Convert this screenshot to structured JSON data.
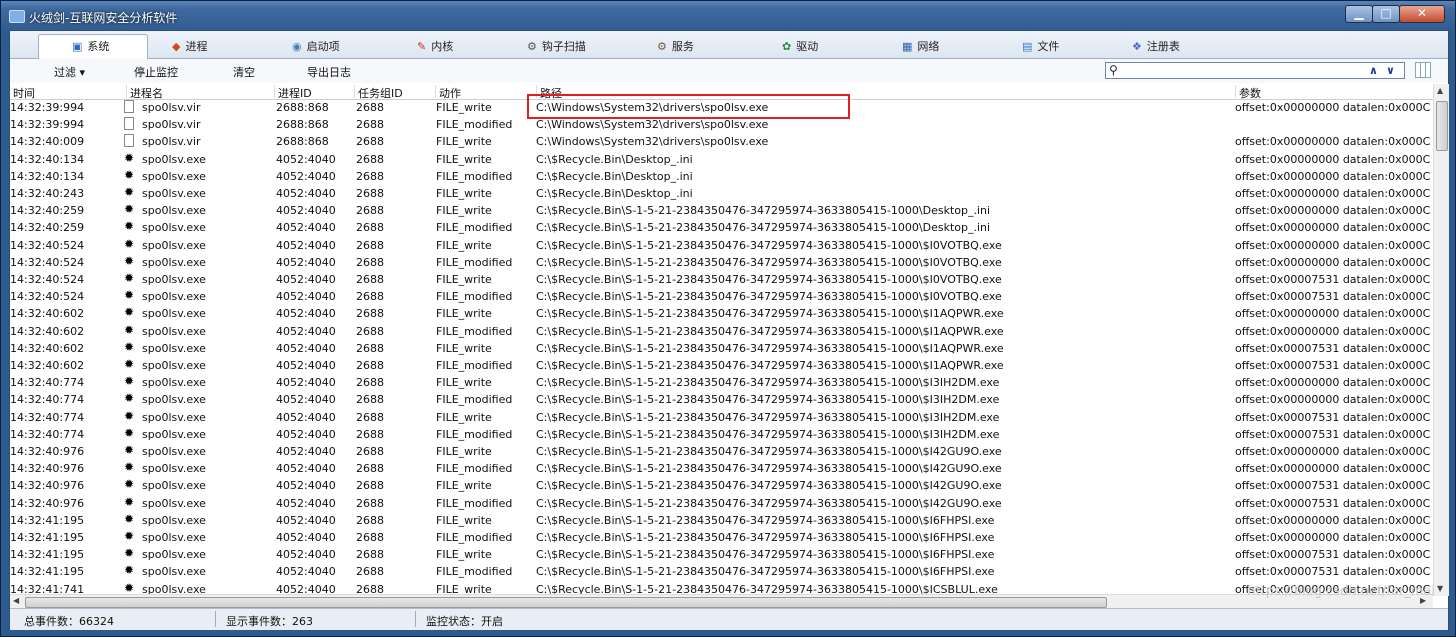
{
  "window": {
    "title": "火绒剑-互联网安全分析软件"
  },
  "tabs": [
    {
      "label": "系统",
      "icon": "system-icon",
      "glyph": "▣",
      "color": "#2b6cc4"
    },
    {
      "label": "进程",
      "icon": "process-icon",
      "glyph": "◆",
      "color": "#d04a1a"
    },
    {
      "label": "启动项",
      "icon": "startup-icon",
      "glyph": "◉",
      "color": "#4a7ab8"
    },
    {
      "label": "内核",
      "icon": "kernel-icon",
      "glyph": "✎",
      "color": "#c03030"
    },
    {
      "label": "钩子扫描",
      "icon": "hook-icon",
      "glyph": "⚙",
      "color": "#555"
    },
    {
      "label": "服务",
      "icon": "service-icon",
      "glyph": "⚙",
      "color": "#7a5a3a"
    },
    {
      "label": "驱动",
      "icon": "driver-icon",
      "glyph": "✿",
      "color": "#2a8a3a"
    },
    {
      "label": "网络",
      "icon": "network-icon",
      "glyph": "▦",
      "color": "#2b5fa8"
    },
    {
      "label": "文件",
      "icon": "file-icon",
      "glyph": "▤",
      "color": "#3a7ac8"
    },
    {
      "label": "注册表",
      "icon": "registry-icon",
      "glyph": "❖",
      "color": "#4a6ab8"
    }
  ],
  "toolbar": {
    "filter": "过滤 ▾",
    "stop": "停止监控",
    "clear": "清空",
    "export": "导出日志"
  },
  "columns": {
    "time": "时间",
    "process": "进程名",
    "pid": "进程ID",
    "taskgroup": "任务组ID",
    "action": "动作",
    "path": "路径",
    "params": "参数"
  },
  "rows": [
    {
      "time": "14:32:39:994",
      "icon": "file",
      "proc": "spo0lsv.vir",
      "pid": "2688:868",
      "tg": "2688",
      "act": "FILE_write",
      "path": "C:\\Windows\\System32\\drivers\\spo0lsv.exe",
      "param": "offset:0x00000000 datalen:0x000C"
    },
    {
      "time": "14:32:39:994",
      "icon": "file",
      "proc": "spo0lsv.vir",
      "pid": "2688:868",
      "tg": "2688",
      "act": "FILE_modified",
      "path": "C:\\Windows\\System32\\drivers\\spo0lsv.exe",
      "param": ""
    },
    {
      "time": "14:32:40:009",
      "icon": "file",
      "proc": "spo0lsv.vir",
      "pid": "2688:868",
      "tg": "2688",
      "act": "FILE_write",
      "path": "C:\\Windows\\System32\\drivers\\spo0lsv.exe",
      "param": "offset:0x00000000 datalen:0x000C"
    },
    {
      "time": "14:32:40:134",
      "icon": "exe",
      "proc": "spo0lsv.exe",
      "pid": "4052:4040",
      "tg": "2688",
      "act": "FILE_write",
      "path": "C:\\$Recycle.Bin\\Desktop_.ini",
      "param": "offset:0x00000000 datalen:0x000C"
    },
    {
      "time": "14:32:40:134",
      "icon": "exe",
      "proc": "spo0lsv.exe",
      "pid": "4052:4040",
      "tg": "2688",
      "act": "FILE_modified",
      "path": "C:\\$Recycle.Bin\\Desktop_.ini",
      "param": "offset:0x00000000 datalen:0x000C"
    },
    {
      "time": "14:32:40:243",
      "icon": "exe",
      "proc": "spo0lsv.exe",
      "pid": "4052:4040",
      "tg": "2688",
      "act": "FILE_write",
      "path": "C:\\$Recycle.Bin\\Desktop_.ini",
      "param": "offset:0x00000000 datalen:0x000C"
    },
    {
      "time": "14:32:40:259",
      "icon": "exe",
      "proc": "spo0lsv.exe",
      "pid": "4052:4040",
      "tg": "2688",
      "act": "FILE_write",
      "path": "C:\\$Recycle.Bin\\S-1-5-21-2384350476-347295974-3633805415-1000\\Desktop_.ini",
      "param": "offset:0x00000000 datalen:0x000C"
    },
    {
      "time": "14:32:40:259",
      "icon": "exe",
      "proc": "spo0lsv.exe",
      "pid": "4052:4040",
      "tg": "2688",
      "act": "FILE_modified",
      "path": "C:\\$Recycle.Bin\\S-1-5-21-2384350476-347295974-3633805415-1000\\Desktop_.ini",
      "param": "offset:0x00000000 datalen:0x000C"
    },
    {
      "time": "14:32:40:524",
      "icon": "exe",
      "proc": "spo0lsv.exe",
      "pid": "4052:4040",
      "tg": "2688",
      "act": "FILE_write",
      "path": "C:\\$Recycle.Bin\\S-1-5-21-2384350476-347295974-3633805415-1000\\$I0VOTBQ.exe",
      "param": "offset:0x00000000 datalen:0x000C"
    },
    {
      "time": "14:32:40:524",
      "icon": "exe",
      "proc": "spo0lsv.exe",
      "pid": "4052:4040",
      "tg": "2688",
      "act": "FILE_modified",
      "path": "C:\\$Recycle.Bin\\S-1-5-21-2384350476-347295974-3633805415-1000\\$I0VOTBQ.exe",
      "param": "offset:0x00000000 datalen:0x000C"
    },
    {
      "time": "14:32:40:524",
      "icon": "exe",
      "proc": "spo0lsv.exe",
      "pid": "4052:4040",
      "tg": "2688",
      "act": "FILE_write",
      "path": "C:\\$Recycle.Bin\\S-1-5-21-2384350476-347295974-3633805415-1000\\$I0VOTBQ.exe",
      "param": "offset:0x00007531 datalen:0x000C"
    },
    {
      "time": "14:32:40:524",
      "icon": "exe",
      "proc": "spo0lsv.exe",
      "pid": "4052:4040",
      "tg": "2688",
      "act": "FILE_modified",
      "path": "C:\\$Recycle.Bin\\S-1-5-21-2384350476-347295974-3633805415-1000\\$I0VOTBQ.exe",
      "param": "offset:0x00007531 datalen:0x000C"
    },
    {
      "time": "14:32:40:602",
      "icon": "exe",
      "proc": "spo0lsv.exe",
      "pid": "4052:4040",
      "tg": "2688",
      "act": "FILE_write",
      "path": "C:\\$Recycle.Bin\\S-1-5-21-2384350476-347295974-3633805415-1000\\$I1AQPWR.exe",
      "param": "offset:0x00000000 datalen:0x000C"
    },
    {
      "time": "14:32:40:602",
      "icon": "exe",
      "proc": "spo0lsv.exe",
      "pid": "4052:4040",
      "tg": "2688",
      "act": "FILE_modified",
      "path": "C:\\$Recycle.Bin\\S-1-5-21-2384350476-347295974-3633805415-1000\\$I1AQPWR.exe",
      "param": "offset:0x00000000 datalen:0x000C"
    },
    {
      "time": "14:32:40:602",
      "icon": "exe",
      "proc": "spo0lsv.exe",
      "pid": "4052:4040",
      "tg": "2688",
      "act": "FILE_write",
      "path": "C:\\$Recycle.Bin\\S-1-5-21-2384350476-347295974-3633805415-1000\\$I1AQPWR.exe",
      "param": "offset:0x00007531 datalen:0x000C"
    },
    {
      "time": "14:32:40:602",
      "icon": "exe",
      "proc": "spo0lsv.exe",
      "pid": "4052:4040",
      "tg": "2688",
      "act": "FILE_modified",
      "path": "C:\\$Recycle.Bin\\S-1-5-21-2384350476-347295974-3633805415-1000\\$I1AQPWR.exe",
      "param": "offset:0x00007531 datalen:0x000C"
    },
    {
      "time": "14:32:40:774",
      "icon": "exe",
      "proc": "spo0lsv.exe",
      "pid": "4052:4040",
      "tg": "2688",
      "act": "FILE_write",
      "path": "C:\\$Recycle.Bin\\S-1-5-21-2384350476-347295974-3633805415-1000\\$I3IH2DM.exe",
      "param": "offset:0x00000000 datalen:0x000C"
    },
    {
      "time": "14:32:40:774",
      "icon": "exe",
      "proc": "spo0lsv.exe",
      "pid": "4052:4040",
      "tg": "2688",
      "act": "FILE_modified",
      "path": "C:\\$Recycle.Bin\\S-1-5-21-2384350476-347295974-3633805415-1000\\$I3IH2DM.exe",
      "param": "offset:0x00000000 datalen:0x000C"
    },
    {
      "time": "14:32:40:774",
      "icon": "exe",
      "proc": "spo0lsv.exe",
      "pid": "4052:4040",
      "tg": "2688",
      "act": "FILE_write",
      "path": "C:\\$Recycle.Bin\\S-1-5-21-2384350476-347295974-3633805415-1000\\$I3IH2DM.exe",
      "param": "offset:0x00007531 datalen:0x000C"
    },
    {
      "time": "14:32:40:774",
      "icon": "exe",
      "proc": "spo0lsv.exe",
      "pid": "4052:4040",
      "tg": "2688",
      "act": "FILE_modified",
      "path": "C:\\$Recycle.Bin\\S-1-5-21-2384350476-347295974-3633805415-1000\\$I3IH2DM.exe",
      "param": "offset:0x00007531 datalen:0x000C"
    },
    {
      "time": "14:32:40:976",
      "icon": "exe",
      "proc": "spo0lsv.exe",
      "pid": "4052:4040",
      "tg": "2688",
      "act": "FILE_write",
      "path": "C:\\$Recycle.Bin\\S-1-5-21-2384350476-347295974-3633805415-1000\\$I42GU9O.exe",
      "param": "offset:0x00000000 datalen:0x000C"
    },
    {
      "time": "14:32:40:976",
      "icon": "exe",
      "proc": "spo0lsv.exe",
      "pid": "4052:4040",
      "tg": "2688",
      "act": "FILE_modified",
      "path": "C:\\$Recycle.Bin\\S-1-5-21-2384350476-347295974-3633805415-1000\\$I42GU9O.exe",
      "param": "offset:0x00000000 datalen:0x000C"
    },
    {
      "time": "14:32:40:976",
      "icon": "exe",
      "proc": "spo0lsv.exe",
      "pid": "4052:4040",
      "tg": "2688",
      "act": "FILE_write",
      "path": "C:\\$Recycle.Bin\\S-1-5-21-2384350476-347295974-3633805415-1000\\$I42GU9O.exe",
      "param": "offset:0x00007531 datalen:0x000C"
    },
    {
      "time": "14:32:40:976",
      "icon": "exe",
      "proc": "spo0lsv.exe",
      "pid": "4052:4040",
      "tg": "2688",
      "act": "FILE_modified",
      "path": "C:\\$Recycle.Bin\\S-1-5-21-2384350476-347295974-3633805415-1000\\$I42GU9O.exe",
      "param": "offset:0x00007531 datalen:0x000C"
    },
    {
      "time": "14:32:41:195",
      "icon": "exe",
      "proc": "spo0lsv.exe",
      "pid": "4052:4040",
      "tg": "2688",
      "act": "FILE_write",
      "path": "C:\\$Recycle.Bin\\S-1-5-21-2384350476-347295974-3633805415-1000\\$I6FHPSI.exe",
      "param": "offset:0x00000000 datalen:0x000C"
    },
    {
      "time": "14:32:41:195",
      "icon": "exe",
      "proc": "spo0lsv.exe",
      "pid": "4052:4040",
      "tg": "2688",
      "act": "FILE_modified",
      "path": "C:\\$Recycle.Bin\\S-1-5-21-2384350476-347295974-3633805415-1000\\$I6FHPSI.exe",
      "param": "offset:0x00000000 datalen:0x000C"
    },
    {
      "time": "14:32:41:195",
      "icon": "exe",
      "proc": "spo0lsv.exe",
      "pid": "4052:4040",
      "tg": "2688",
      "act": "FILE_write",
      "path": "C:\\$Recycle.Bin\\S-1-5-21-2384350476-347295974-3633805415-1000\\$I6FHPSI.exe",
      "param": "offset:0x00007531 datalen:0x000C"
    },
    {
      "time": "14:32:41:195",
      "icon": "exe",
      "proc": "spo0lsv.exe",
      "pid": "4052:4040",
      "tg": "2688",
      "act": "FILE_modified",
      "path": "C:\\$Recycle.Bin\\S-1-5-21-2384350476-347295974-3633805415-1000\\$I6FHPSI.exe",
      "param": "offset:0x00007531 datalen:0x000C"
    },
    {
      "time": "14:32:41:741",
      "icon": "exe",
      "proc": "spo0lsv.exe",
      "pid": "4052:4040",
      "tg": "2688",
      "act": "FILE_write",
      "path": "C:\\$Recycle.Bin\\S-1-5-21-2384350476-347295974-3633805415-1000\\$ICSBLUL.exe",
      "param": "offset:0x00000000 datalen:0x000C"
    }
  ],
  "status": {
    "total": "总事件数：66324",
    "shown": "显示事件数：263",
    "monitor": "监控状态：开启"
  },
  "watermark": "https://blog.csdn.net/for_mai"
}
